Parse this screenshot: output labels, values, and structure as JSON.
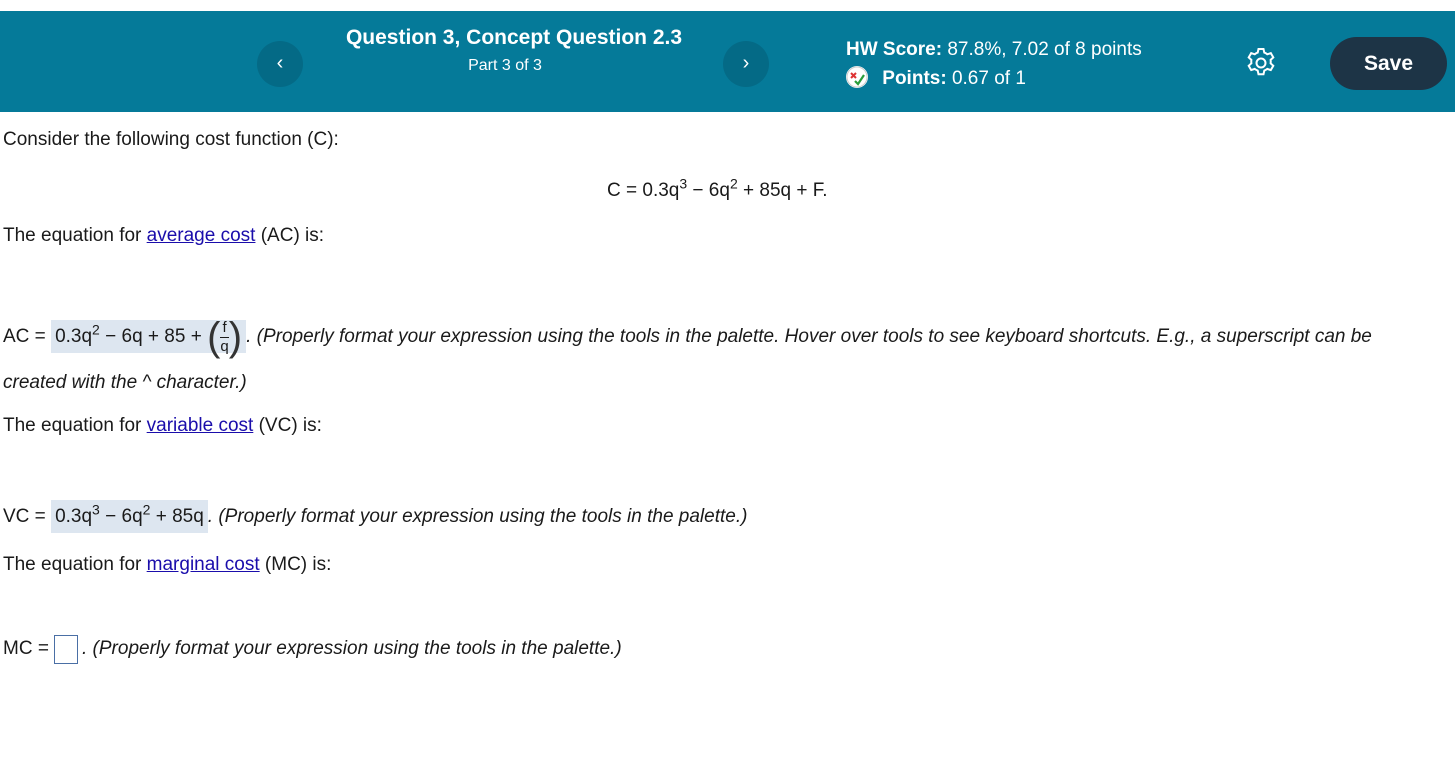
{
  "header": {
    "prev_icon": "‹",
    "next_icon": "›",
    "question_title": "Question 3, Concept Question 2.3",
    "part_label": "Part 3 of 3",
    "hw_score_label": "HW Score:",
    "hw_score_value": "87.8%, 7.02 of 8 points",
    "points_label": "Points:",
    "points_value": "0.67 of 1",
    "save_label": "Save"
  },
  "content": {
    "intro": "Consider the following cost function (C):",
    "cost_function": {
      "lead": "C = 0.3q",
      "exp1": "3",
      "mid": " − 6q",
      "exp2": "2",
      "tail": " + 85q + F."
    },
    "ac_prompt": {
      "pre": "The equation for ",
      "link": "average cost",
      "post": " (AC) is:"
    },
    "ac_answer": {
      "label": "AC = ",
      "t1": "0.3q",
      "e1": "2",
      "t2": " − 6q + 85 + ",
      "frac_num": "f",
      "frac_den": "q"
    },
    "ac_note_line1": ". (Properly format your expression using the tools in the palette. Hover over tools to see keyboard shortcuts. E.g., a superscript can be",
    "ac_note_line2": "created with the ^ character.)",
    "vc_prompt": {
      "pre": "The equation for ",
      "link": "variable cost",
      "post": " (VC) is:"
    },
    "vc_answer": {
      "label": "VC = ",
      "t1": "0.3q",
      "e1": "3",
      "t2": " − 6q",
      "e2": "2",
      "t3": " + 85q"
    },
    "vc_note": ". (Properly format your expression using the tools in the palette.)",
    "mc_prompt": {
      "pre": "The equation for ",
      "link": "marginal cost",
      "post": " (MC) is:"
    },
    "mc_label": "MC = ",
    "mc_note": ". (Properly format your expression using the tools in the palette.)"
  },
  "colors": {
    "header_bg": "#057a99",
    "save_bg": "#1d3446",
    "answer_bg": "#dde6f0",
    "link": "#1a0dab"
  }
}
